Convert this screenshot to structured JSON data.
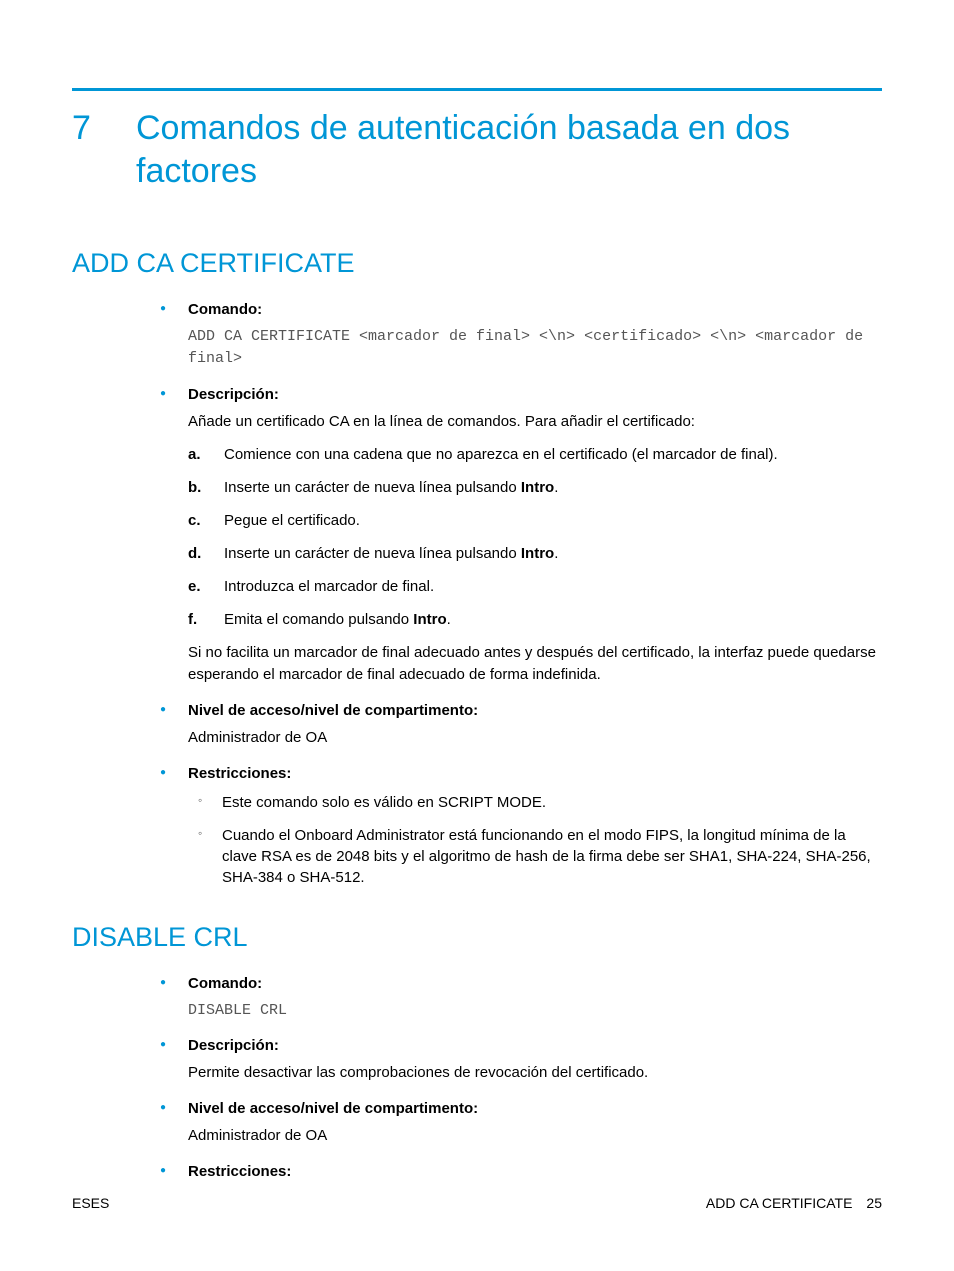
{
  "chapter": {
    "number": "7",
    "title": "Comandos de autenticación basada en dos factores"
  },
  "section1": {
    "heading": "ADD CA CERTIFICATE",
    "comando_label": "Comando:",
    "comando_text": "ADD CA CERTIFICATE <marcador de final> <\\n> <certificado> <\\n> <marcador de final>",
    "descripcion_label": "Descripción:",
    "descripcion_intro": "Añade un certificado CA en la línea de comandos. Para añadir el certificado:",
    "steps": {
      "a": {
        "letter": "a.",
        "text": "Comience con una cadena que no aparezca en el certificado (el marcador de final)."
      },
      "b": {
        "letter": "b.",
        "pre": "Inserte un carácter de nueva línea pulsando ",
        "bold": "Intro",
        "post": "."
      },
      "c": {
        "letter": "c.",
        "text": "Pegue el certificado."
      },
      "d": {
        "letter": "d.",
        "pre": "Inserte un carácter de nueva línea pulsando ",
        "bold": "Intro",
        "post": "."
      },
      "e": {
        "letter": "e.",
        "text": "Introduzca el marcador de final."
      },
      "f": {
        "letter": "f.",
        "pre": "Emita el comando pulsando ",
        "bold": "Intro",
        "post": "."
      }
    },
    "descripcion_note": "Si no facilita un marcador de final adecuado antes y después del certificado, la interfaz puede quedarse esperando el marcador de final adecuado de forma indefinida.",
    "nivel_label": "Nivel de acceso/nivel de compartimento:",
    "nivel_text": "Administrador de OA",
    "restricciones_label": "Restricciones:",
    "restricciones": {
      "r1": "Este comando solo es válido en SCRIPT MODE.",
      "r2": "Cuando el Onboard Administrator está funcionando en el modo FIPS, la longitud mínima de la clave RSA es de 2048 bits y el algoritmo de hash de la firma debe ser SHA1, SHA-224, SHA-256, SHA-384 o SHA-512."
    }
  },
  "section2": {
    "heading": "DISABLE CRL",
    "comando_label": "Comando:",
    "comando_text": "DISABLE CRL",
    "descripcion_label": "Descripción:",
    "descripcion_text": "Permite desactivar las comprobaciones de revocación del certificado.",
    "nivel_label": "Nivel de acceso/nivel de compartimento:",
    "nivel_text": "Administrador de OA",
    "restricciones_label": "Restricciones:"
  },
  "footer": {
    "left": "ESES",
    "right_text": "ADD CA CERTIFICATE",
    "page_num": "25"
  }
}
